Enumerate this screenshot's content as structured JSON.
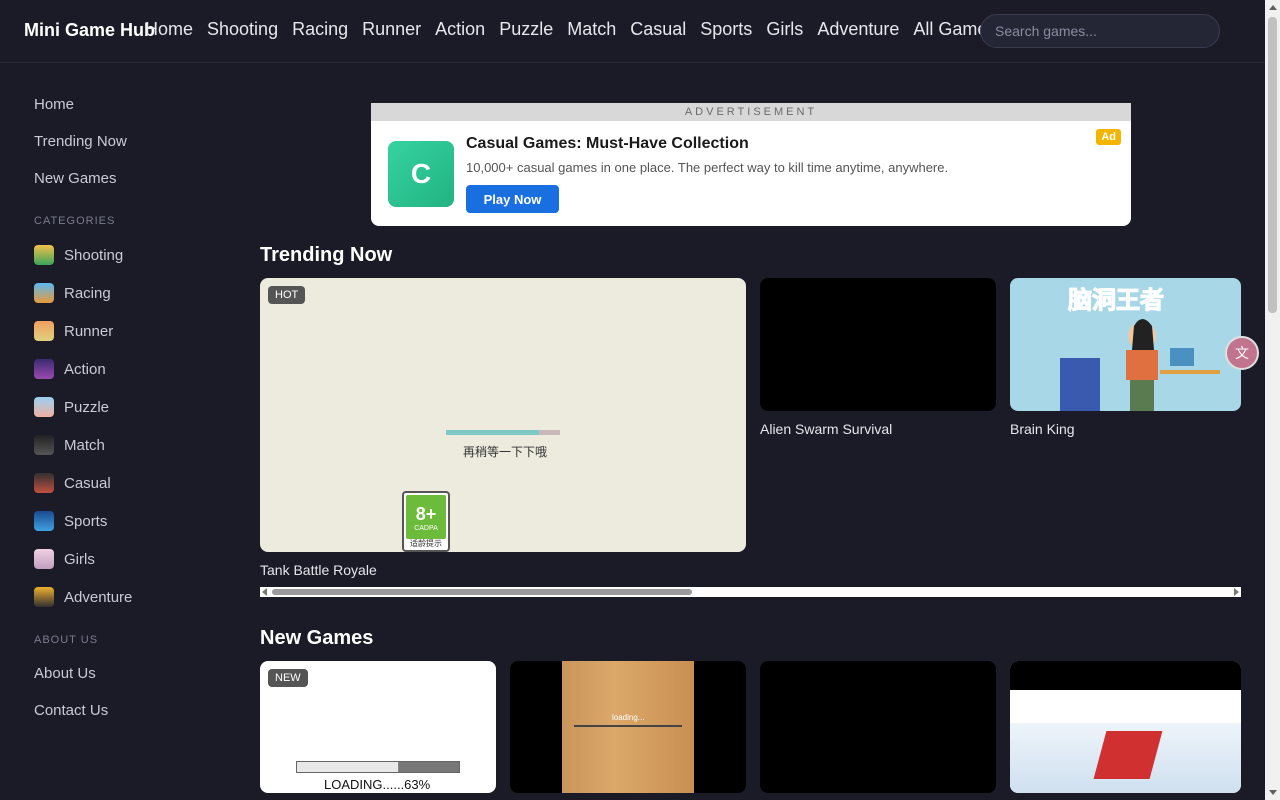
{
  "header": {
    "logo": "Mini Game Hub",
    "nav": [
      "Home",
      "Shooting",
      "Racing",
      "Runner",
      "Action",
      "Puzzle",
      "Match",
      "Casual",
      "Sports",
      "Girls",
      "Adventure",
      "All Games"
    ],
    "search_placeholder": "Search games..."
  },
  "sidebar": {
    "links": [
      "Home",
      "Trending Now",
      "New Games"
    ],
    "categories_heading": "CATEGORIES",
    "categories": [
      "Shooting",
      "Racing",
      "Runner",
      "Action",
      "Puzzle",
      "Match",
      "Casual",
      "Sports",
      "Girls",
      "Adventure"
    ],
    "about_heading": "ABOUT US",
    "about_links": [
      "About Us",
      "Contact Us"
    ]
  },
  "ad": {
    "label": "ADVERTISEMENT",
    "logo_letter": "C",
    "title": "Casual Games: Must-Have Collection",
    "description": "10,000+ casual games in one place. The perfect way to kill time anytime, anywhere.",
    "button": "Play Now",
    "badge": "Ad"
  },
  "trending": {
    "title": "Trending Now",
    "cards": [
      {
        "name": "Tank Battle Royale",
        "tag": "HOT",
        "loading_text": "再稍等一下下哦",
        "rating": "8+",
        "rating_org": "CADPA",
        "rating_note": "适龄提示",
        "progress": 0.82
      },
      {
        "name": "Alien Swarm Survival"
      },
      {
        "name": "Brain King",
        "art_title": "脑洞王者"
      }
    ]
  },
  "new_games": {
    "title": "New Games",
    "cards": [
      {
        "tag": "NEW",
        "loading_text": "LOADING......63%",
        "progress": 0.63
      },
      {
        "loading_text": "loading..."
      },
      {},
      {}
    ]
  }
}
